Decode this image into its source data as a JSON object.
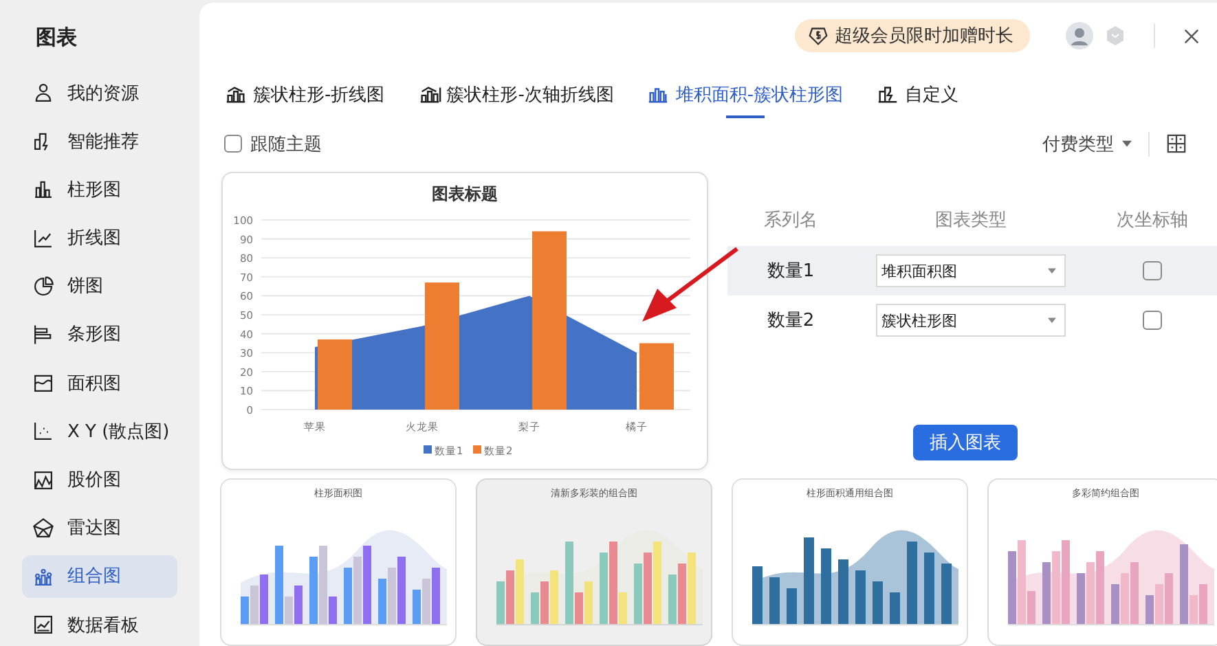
{
  "sidebar": {
    "title": "图表",
    "items": [
      {
        "label": "我的资源",
        "selected": false
      },
      {
        "label": "智能推荐",
        "selected": false
      },
      {
        "label": "柱形图",
        "selected": false
      },
      {
        "label": "折线图",
        "selected": false
      },
      {
        "label": "饼图",
        "selected": false
      },
      {
        "label": "条形图",
        "selected": false
      },
      {
        "label": "面积图",
        "selected": false
      },
      {
        "label": "X Y (散点图)",
        "selected": false
      },
      {
        "label": "股价图",
        "selected": false
      },
      {
        "label": "雷达图",
        "selected": false
      },
      {
        "label": "组合图",
        "selected": true
      },
      {
        "label": "数据看板",
        "selected": false
      }
    ]
  },
  "header": {
    "promo": "超级会员限时加赠时长"
  },
  "tabs": [
    {
      "label": "簇状柱形-折线图",
      "selected": false
    },
    {
      "label": "簇状柱形-次轴折线图",
      "selected": false
    },
    {
      "label": "堆积面积-簇状柱形图",
      "selected": true
    },
    {
      "label": "自定义",
      "selected": false
    }
  ],
  "follow_theme": {
    "label": "跟随主题",
    "checked": false
  },
  "filter": {
    "label": "付费类型"
  },
  "preview": {
    "chart_data": {
      "type": "bar",
      "title": "图表标题",
      "categories": [
        "苹果",
        "火龙果",
        "梨子",
        "橘子"
      ],
      "series": [
        {
          "name": "数量1",
          "type": "area",
          "color": "#4472c4",
          "values": [
            33,
            44,
            60,
            30
          ]
        },
        {
          "name": "数量2",
          "type": "bar",
          "color": "#ed7d31",
          "values": [
            37,
            67,
            94,
            35
          ]
        }
      ],
      "grid": true,
      "legend": true,
      "ylim": [
        0,
        100
      ],
      "yticks": [
        0,
        10,
        20,
        30,
        40,
        50,
        60,
        70,
        80,
        90,
        100
      ]
    }
  },
  "series_table": {
    "columns": [
      "系列名",
      "图表类型",
      "次坐标轴"
    ],
    "rows": [
      {
        "name": "数量1",
        "chart_type": "堆积面积图",
        "secondary_axis": false,
        "selected": true
      },
      {
        "name": "数量2",
        "chart_type": "簇状柱形图",
        "secondary_axis": false,
        "selected": false
      }
    ]
  },
  "insert_button": "插入图表",
  "templates": [
    {
      "title": "柱形面积图",
      "selected": false
    },
    {
      "title": "清新多彩装的组合图",
      "selected": true
    },
    {
      "title": "柱形面积通用组合图",
      "selected": false
    },
    {
      "title": "多彩简约组合图",
      "selected": false
    }
  ]
}
